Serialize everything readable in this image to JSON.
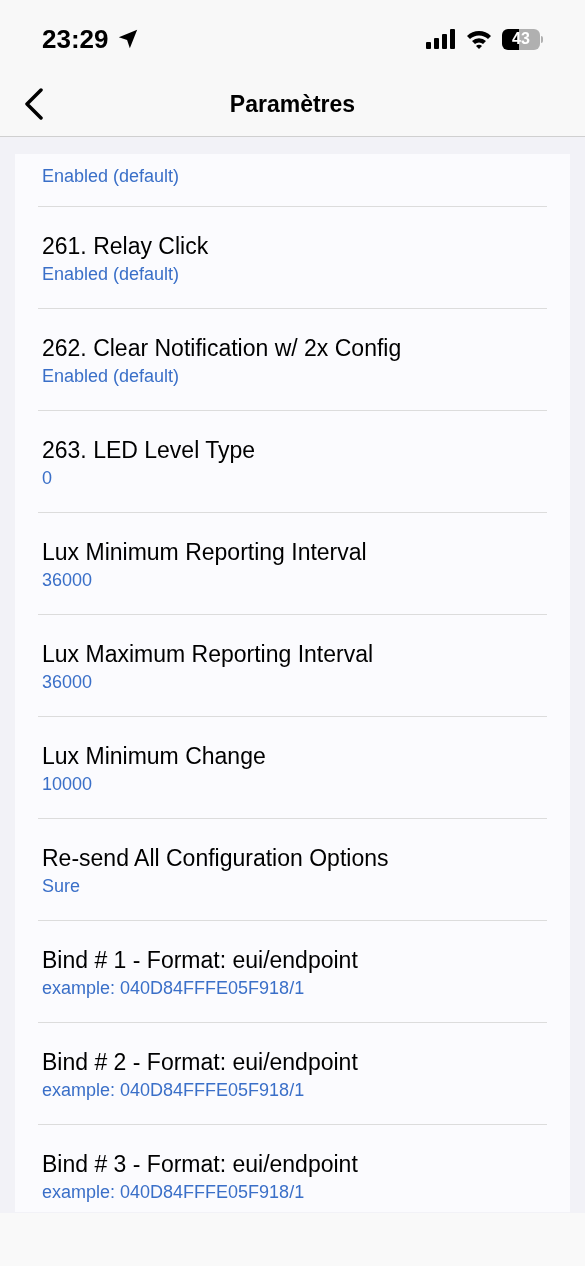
{
  "status_bar": {
    "time": "23:29",
    "battery": "43"
  },
  "nav": {
    "title": "Paramètres"
  },
  "settings": [
    {
      "value": "Enabled (default)"
    },
    {
      "title": "261. Relay Click",
      "value": "Enabled (default)"
    },
    {
      "title": "262. Clear Notification w/ 2x Config",
      "value": "Enabled (default)"
    },
    {
      "title": "263. LED Level Type",
      "value": "0"
    },
    {
      "title": "Lux Minimum Reporting Interval",
      "value": "36000"
    },
    {
      "title": "Lux Maximum Reporting Interval",
      "value": "36000"
    },
    {
      "title": "Lux Minimum Change",
      "value": "10000"
    },
    {
      "title": "Re-send All Configuration Options",
      "value": "Sure"
    },
    {
      "title": "Bind # 1 - Format: eui/endpoint",
      "value": "example: 040D84FFFE05F918/1"
    },
    {
      "title": "Bind # 2 - Format: eui/endpoint",
      "value": "example: 040D84FFFE05F918/1"
    },
    {
      "title": "Bind # 3 - Format: eui/endpoint",
      "value": "example: 040D84FFFE05F918/1"
    }
  ]
}
